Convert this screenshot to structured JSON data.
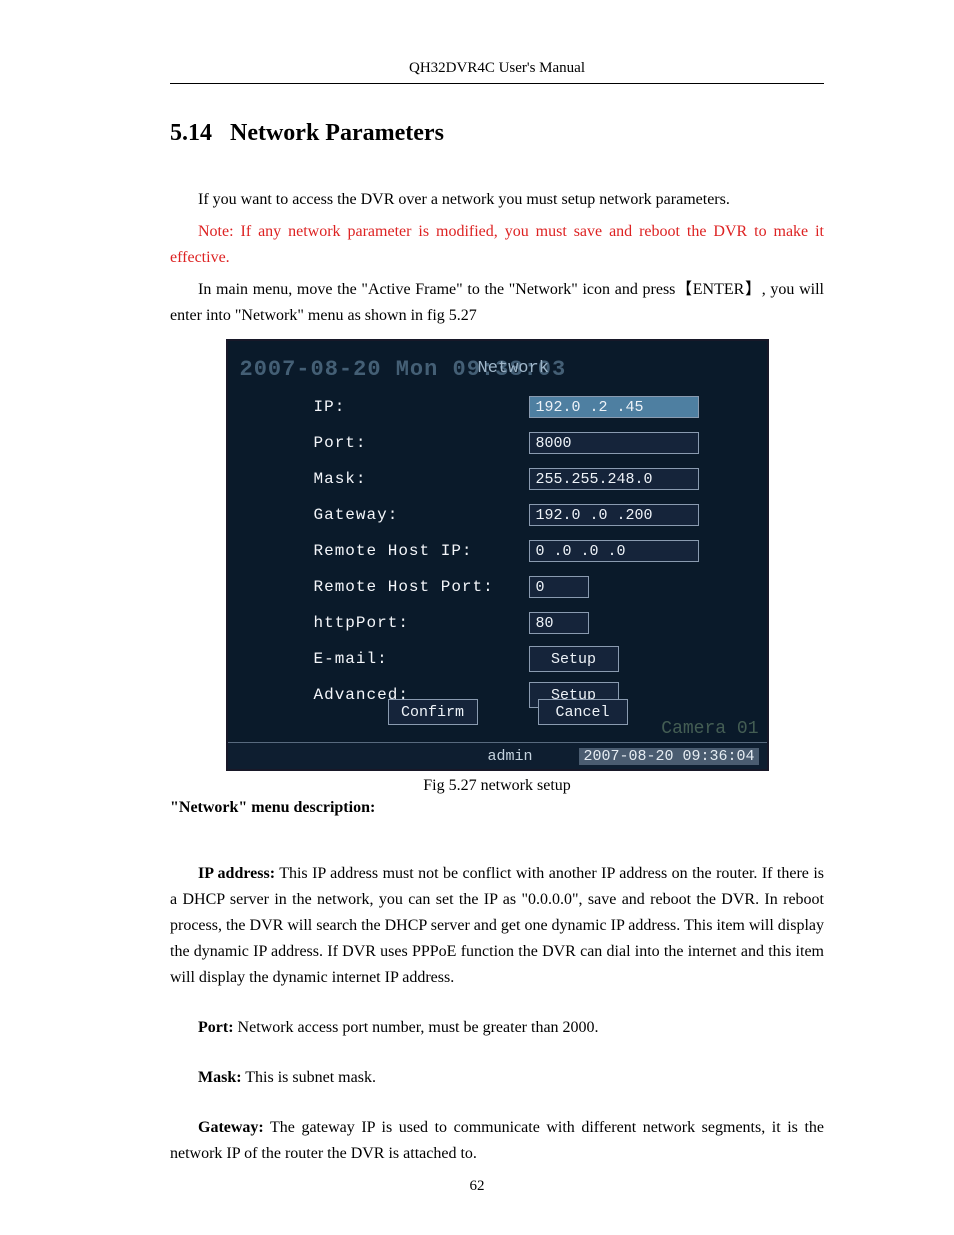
{
  "header": {
    "title": "QH32DVR4C User's Manual"
  },
  "section": {
    "number": "5.14",
    "title": "Network Parameters"
  },
  "intro": {
    "p1": "If you want to access the DVR over a network you must setup network parameters.",
    "note": "Note: If any network parameter is modified, you must save and reboot the DVR to make it effective.",
    "p2a": "In main menu, move the \"Active Frame\" to the \"Network\" icon and press",
    "enter": "【ENTER】",
    "p2b": ", you will enter into \"Network\" menu as shown in fig 5.27"
  },
  "figure": {
    "bg_datetime": "2007-08-20 Mon 09:38:03",
    "title": "Network",
    "rows": {
      "ip": {
        "label": "IP:",
        "value": "192.0  .2  .45",
        "selected": true
      },
      "port": {
        "label": "Port:",
        "value": "8000"
      },
      "mask": {
        "label": "Mask:",
        "value": "255.255.248.0"
      },
      "gateway": {
        "label": "Gateway:",
        "value": "192.0  .0  .200"
      },
      "rhost_ip": {
        "label": "Remote Host IP:",
        "value": "0   .0  .0  .0"
      },
      "rhost_port": {
        "label": "Remote Host Port:",
        "value": "0"
      },
      "http_port": {
        "label": "httpPort:",
        "value": "80"
      },
      "email": {
        "label": "E-mail:",
        "button": "Setup"
      },
      "advanced": {
        "label": "Advanced:",
        "button": "Setup"
      }
    },
    "buttons": {
      "confirm": "Confirm",
      "cancel": "Cancel"
    },
    "camera_overlay": "Camera 01",
    "status": {
      "user": "admin",
      "datetime": "2007-08-20 09:36:04"
    }
  },
  "caption": "Fig 5.27 network setup",
  "desc_heading": "\"Network\" menu description:",
  "descriptions": {
    "ip": {
      "label": "IP address:",
      "text": " This IP address must not be conflict with another IP address on the router. If there is a DHCP server in the network, you can set the IP as \"0.0.0.0\", save and reboot the DVR. In reboot process, the DVR will search the DHCP server and get one dynamic IP address. This item will display the dynamic IP address. If DVR uses PPPoE function the DVR can dial into the internet and this item will display the dynamic internet IP address."
    },
    "port": {
      "label": "Port:",
      "text": " Network access port number, must be greater than 2000."
    },
    "mask": {
      "label": "Mask:",
      "text": " This is subnet mask."
    },
    "gateway": {
      "label": "Gateway:",
      "text": " The gateway IP is used to communicate with different network segments, it is the network IP of the router the DVR is attached to."
    }
  },
  "page_number": "62"
}
